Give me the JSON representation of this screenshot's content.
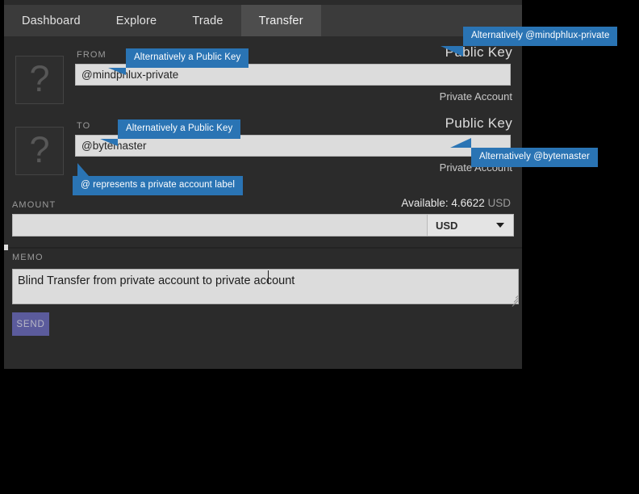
{
  "tabs": [
    {
      "label": "Dashboard",
      "active": false
    },
    {
      "label": "Explore",
      "active": false
    },
    {
      "label": "Trade",
      "active": false
    },
    {
      "label": "Transfer",
      "active": true
    }
  ],
  "from": {
    "label": "FROM",
    "right_label": "Public Key",
    "value": "@mindphlux-private",
    "placeholder": "",
    "sub_label": "Private Account",
    "avatar_glyph": "?"
  },
  "to": {
    "label": "TO",
    "right_label": "Public Key",
    "value": "@bytemaster",
    "placeholder": "",
    "sub_label": "Private Account",
    "avatar_glyph": "?"
  },
  "amount": {
    "label": "AMOUNT",
    "value": "",
    "placeholder": "",
    "available_text": "Available: 4.6622",
    "available_unit": "USD",
    "currency": "USD",
    "currency_options": [
      "USD"
    ]
  },
  "memo": {
    "label": "MEMO",
    "value": "Blind Transfer from private account to private account",
    "placeholder": ""
  },
  "send_button": {
    "label": "SEND"
  },
  "callouts": [
    {
      "id": "from-public-key",
      "text": "Alternatively a Public Key"
    },
    {
      "id": "from-alternative-account",
      "text": "Alternatively @mindphlux-private"
    },
    {
      "id": "to-public-key",
      "text": "Alternatively a Public Key"
    },
    {
      "id": "to-alternative-account",
      "text": "Alternatively @bytemaster"
    },
    {
      "id": "at-symbol-explanation",
      "text": "@ represents a private account label"
    }
  ],
  "colors": {
    "panel_bg": "#2b2b2b",
    "tabbar_bg": "#3b3b3b",
    "tab_active_bg": "#4d4d4d",
    "input_bg": "#dcdcdc",
    "callout_blue": "#2a74b4",
    "send_purple": "#5b5b9c",
    "page_bg": "#000000"
  }
}
